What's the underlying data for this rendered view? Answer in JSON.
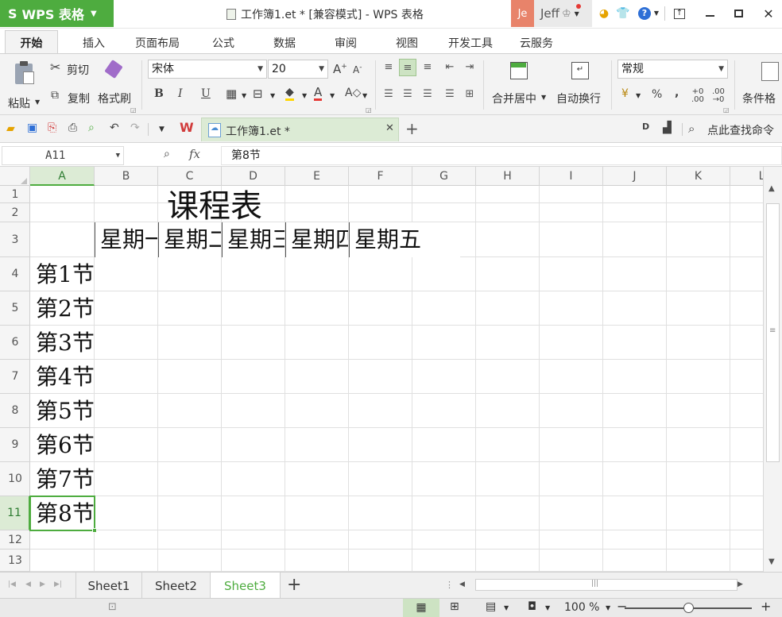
{
  "titlebar": {
    "app_logo": "S",
    "app_name": "WPS 表格",
    "doc_title": "工作簿1.et * [兼容模式] - WPS 表格",
    "user_initials": "Je",
    "user_name": "Jeff"
  },
  "ribbon_tabs": [
    "开始",
    "插入",
    "页面布局",
    "公式",
    "数据",
    "审阅",
    "视图",
    "开发工具",
    "云服务"
  ],
  "ribbon": {
    "paste_label": "粘贴",
    "cut_label": "剪切",
    "copy_label": "复制",
    "format_painter_label": "格式刷",
    "font_name": "宋体",
    "font_size": "20",
    "merge_center_label": "合并居中",
    "wrap_text_label": "自动换行",
    "number_format": "常规",
    "percent_symbol": "%",
    "comma_symbol": ",",
    "conditional_label": "条件格"
  },
  "quick_access": {
    "doc_tab_label": "工作簿1.et *",
    "search_commands": "点此查找命令"
  },
  "formula_bar": {
    "name_box": "A11",
    "fx": "fx",
    "value": "第8节"
  },
  "grid": {
    "columns": [
      "A",
      "B",
      "C",
      "D",
      "E",
      "F",
      "G",
      "H",
      "I",
      "J",
      "K",
      "L"
    ],
    "rows": [
      "1",
      "2",
      "3",
      "4",
      "5",
      "6",
      "7",
      "8",
      "9",
      "10",
      "11",
      "12",
      "13"
    ],
    "selected_cell": "A11",
    "title_cell": "课程表",
    "weekday_cells": [
      "星期一",
      "星期二",
      "星期三",
      "星期四",
      "星期五"
    ],
    "period_cells": [
      "第1节",
      "第2节",
      "第3节",
      "第4节",
      "第5节",
      "第6节",
      "第7节",
      "第8节"
    ]
  },
  "sheet_tabs": [
    "Sheet1",
    "Sheet2",
    "Sheet3"
  ],
  "active_sheet": "Sheet3",
  "statusbar": {
    "zoom": "100 %"
  },
  "colors": {
    "accent": "#4eac3f",
    "selection_fill": "#dcebd5"
  }
}
